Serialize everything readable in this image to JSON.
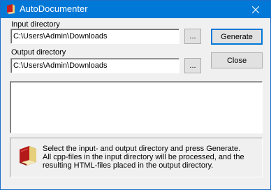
{
  "window": {
    "title": "AutoDocumenter",
    "title_icon": "book-icon",
    "close_icon": "close-icon"
  },
  "form": {
    "input_label": "Input directory",
    "input_value": "C:\\Users\\Admin\\Downloads",
    "input_browse": "...",
    "output_label": "Output directory",
    "output_value": "C:\\Users\\Admin\\Downloads",
    "output_browse": "..."
  },
  "buttons": {
    "generate": "Generate",
    "close": "Close"
  },
  "log": {
    "content": ""
  },
  "info": {
    "icon": "book-icon",
    "lines": [
      "Select the input- and output directory and press Generate.",
      "All cpp-files in the input directory will be processed, and the",
      "resulting HTML-files placed in the output directory."
    ]
  },
  "colors": {
    "titlebar": "#0078d7",
    "title_text": "#ffffff",
    "dialog_bg": "#f0f0f0",
    "button_bg": "#e1e1e1",
    "default_button_border": "#0078d7"
  }
}
